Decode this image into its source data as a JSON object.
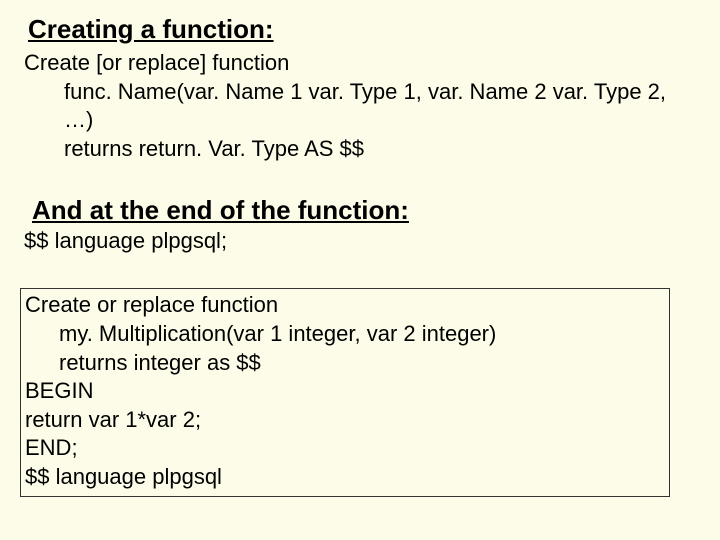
{
  "section1": {
    "heading": "Creating a function:",
    "line1": "Create [or replace] function",
    "line2": "func. Name(var. Name 1 var. Type 1, var. Name 2 var. Type 2, …)",
    "line3": "returns return. Var. Type AS $$"
  },
  "section2": {
    "heading": "And at the end of the function:",
    "line1": "$$ language plpgsql;"
  },
  "code": {
    "l1": "Create or replace function",
    "l2": "my. Multiplication(var 1 integer, var 2 integer)",
    "l3": "returns integer as $$",
    "l4": "BEGIN",
    "l5": "return var 1*var 2;",
    "l6": "END;",
    "l7": "$$ language plpgsql"
  }
}
